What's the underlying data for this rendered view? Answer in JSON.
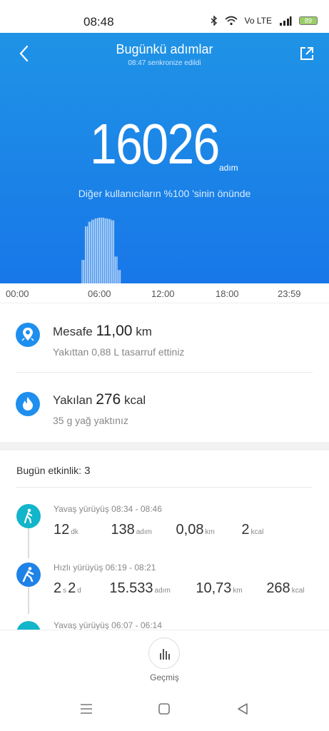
{
  "status": {
    "time": "08:48",
    "network": "Vo LTE",
    "battery": "89"
  },
  "header": {
    "title": "Bugünkü adımlar",
    "subtitle": "08:47 senkronize edildi"
  },
  "summary": {
    "steps": "16026",
    "unit": "adım",
    "ahead_text": "Diğer kullanıcıların %100 'sinin önünde"
  },
  "chart_data": {
    "type": "bar",
    "x_ticks": [
      "00:00",
      "06:00",
      "12:00",
      "18:00",
      "23:59"
    ],
    "x_range": [
      "00:00",
      "23:59"
    ],
    "bin_minutes": 15,
    "series": [
      {
        "bins": [
          {
            "time": "05:45",
            "value": 0.35
          },
          {
            "time": "06:00",
            "value": 0.85
          },
          {
            "time": "06:15",
            "value": 0.92
          },
          {
            "time": "06:30",
            "value": 0.95
          },
          {
            "time": "06:45",
            "value": 0.97
          },
          {
            "time": "07:00",
            "value": 0.98
          },
          {
            "time": "07:15",
            "value": 0.98
          },
          {
            "time": "07:30",
            "value": 0.97
          },
          {
            "time": "07:45",
            "value": 0.96
          },
          {
            "time": "08:00",
            "value": 0.94
          },
          {
            "time": "08:15",
            "value": 0.4
          },
          {
            "time": "08:30",
            "value": 0.2
          }
        ]
      }
    ],
    "grid": false,
    "colors": {
      "bar": "#ffffff",
      "background": "#1a83e8"
    }
  },
  "metrics": [
    {
      "label": "Mesafe",
      "value": "11,00",
      "unit": "km",
      "sub": "Yakıttan 0,88 L tasarruf ettiniz",
      "icon": "location-pin-icon"
    },
    {
      "label": "Yakılan",
      "value": "276",
      "unit": "kcal",
      "sub": "35 g yağ yaktınız",
      "icon": "flame-icon"
    }
  ],
  "activity_count": {
    "label": "Bugün etkinlik:",
    "value": "3"
  },
  "activities": [
    {
      "title": "Yavaş yürüyüş 08:34 - 08:46",
      "values": [
        {
          "v": "12",
          "u": "dk"
        },
        {
          "v": "138",
          "u": "adım"
        },
        {
          "v": "0,08",
          "u": "km"
        },
        {
          "v": "2",
          "u": "kcal"
        }
      ],
      "color": "#12b5c9"
    },
    {
      "title": "Hızlı yürüyüş 06:19 - 08:21",
      "values": [
        {
          "v": "2",
          "u": "s"
        },
        {
          "v": "2",
          "u": "d"
        },
        {
          "v": "15.533",
          "u": "adım"
        },
        {
          "v": "10,73",
          "u": "km"
        },
        {
          "v": "268",
          "u": "kcal"
        }
      ],
      "color": "#1f82e6"
    },
    {
      "title": "Yavaş yürüyüş 06:07 - 06:14",
      "color": "#12b5c9"
    }
  ],
  "bottom": {
    "history_label": "Geçmiş"
  },
  "colors": {
    "accent": "#1a83e8",
    "teal": "#12b5c9"
  }
}
